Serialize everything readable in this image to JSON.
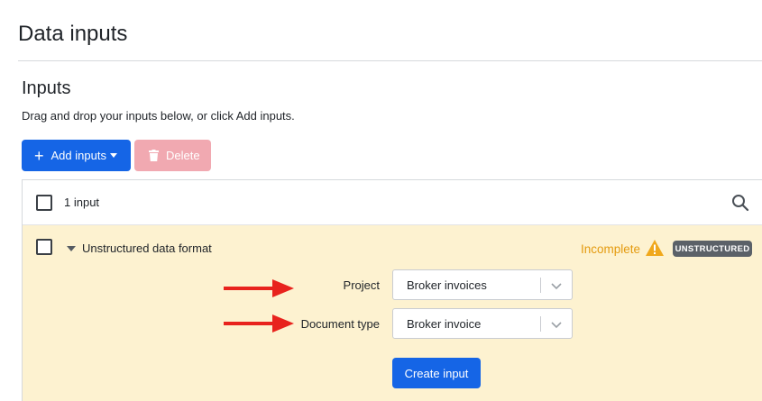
{
  "page": {
    "title": "Data inputs"
  },
  "inputs": {
    "title": "Inputs",
    "hint": "Drag and drop your inputs below, or click Add inputs."
  },
  "toolbar": {
    "add_label": "Add inputs",
    "delete_label": "Delete"
  },
  "list": {
    "count_label": "1 input",
    "rows": [
      {
        "title": "Unstructured data format",
        "status": "Incomplete",
        "badge": "UNSTRUCTURED",
        "fields": [
          {
            "label": "Project",
            "value": "Broker invoices"
          },
          {
            "label": "Document type",
            "value": "Broker invoice"
          }
        ],
        "create_label": "Create input"
      }
    ]
  },
  "colors": {
    "primary": "#1565e6",
    "danger_disabled": "#f1a9b1",
    "row_warning_bg": "#fdf2d0",
    "status_warning": "#e49b0f",
    "badge_bg": "#5b6168",
    "annotation_arrow": "#e8231d"
  },
  "icons": [
    "plus-icon",
    "caret-down-icon",
    "trash-icon",
    "search-icon",
    "warning-icon",
    "chevron-down-icon",
    "arrow-right-icon"
  ]
}
